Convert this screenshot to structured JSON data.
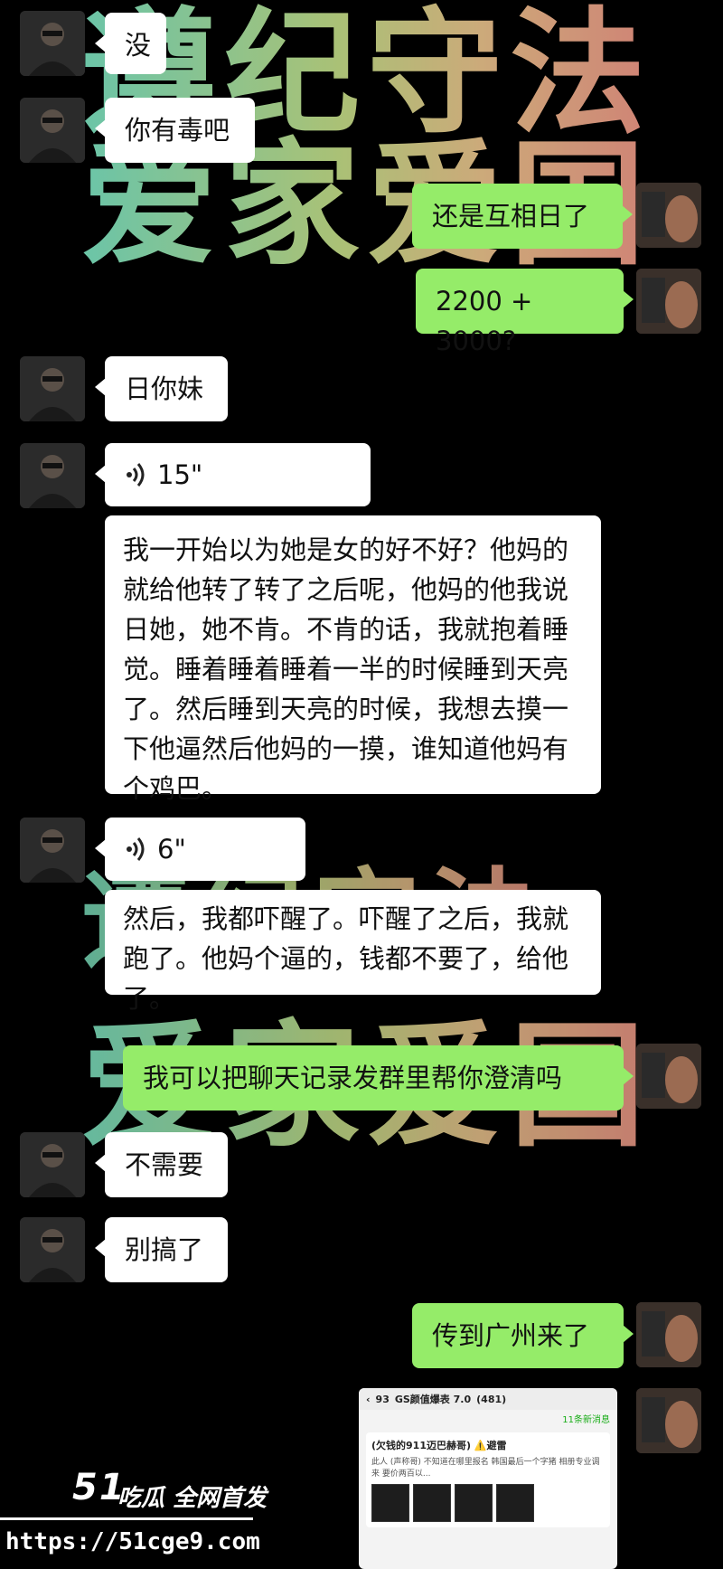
{
  "watermark": {
    "line1": "遵纪守法",
    "line2": "爱家爱国",
    "line3": "遵纪守法",
    "line4": "爱家爱国"
  },
  "messages": [
    {
      "side": "left",
      "text": "没"
    },
    {
      "side": "left",
      "text": "你有毒吧"
    },
    {
      "side": "right",
      "text": "还是互相日了"
    },
    {
      "side": "right",
      "text": "2200 + 3000?"
    },
    {
      "side": "left",
      "text": "日你妹"
    },
    {
      "side": "left",
      "type": "voice",
      "duration": "15\""
    },
    {
      "side": "left",
      "type": "transcript",
      "text": "我一开始以为她是女的好不好？他妈的就给他转了转了之后呢，他妈的他我说日她，她不肯。不肯的话，我就抱着睡觉。睡着睡着睡着一半的时候睡到天亮了。然后睡到天亮的时候，我想去摸一下他逼然后他妈的一摸，谁知道他妈有个鸡巴。"
    },
    {
      "side": "left",
      "type": "voice",
      "duration": "6\""
    },
    {
      "side": "left",
      "type": "transcript",
      "text": "然后，我都吓醒了。吓醒了之后，我就跑了。他妈个逼的，钱都不要了，给他了。"
    },
    {
      "side": "right",
      "text": "我可以把聊天记录发群里帮你澄清吗"
    },
    {
      "side": "left",
      "text": "不需要"
    },
    {
      "side": "left",
      "text": "别搞了"
    },
    {
      "side": "right",
      "text": "传到广州来了"
    }
  ],
  "screenshot_card": {
    "back": "93",
    "group_title": "GS颜值爆表 7.0",
    "count": "(481)",
    "unread": "11条新消息",
    "card_title": "(欠钱的911迈巴赫哥) ⚠️避雷",
    "card_text": "此人 (声称哥) 不知道在哪里报名 韩国最后一个字猪 相册专业调来 要价两百以..."
  },
  "logo": {
    "brand": "51",
    "tagline": "吃瓜 全网首发",
    "url": "https://51cge9.com"
  }
}
